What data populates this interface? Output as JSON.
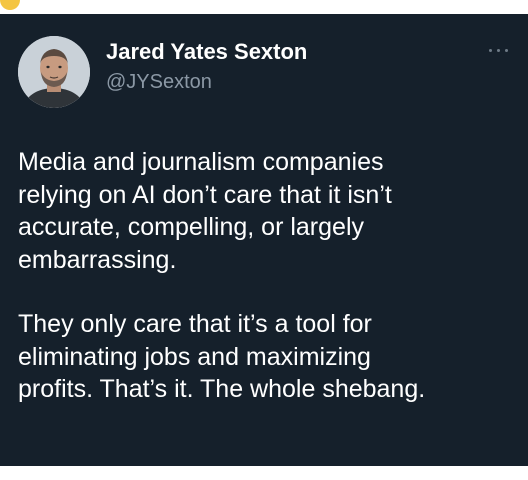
{
  "tweet": {
    "author": {
      "display_name": "Jared Yates Sexton",
      "handle": "@JYSexton",
      "avatar_icon": "profile-photo"
    },
    "more_icon": "more-horizontal-icon",
    "paragraphs": [
      {
        "lines": [
          "Media and journalism companies",
          "relying on AI don’t care that it isn’t",
          "accurate, compelling, or largely",
          "embarrassing."
        ]
      },
      {
        "lines": [
          "They only care that it’s a tool for",
          "eliminating jobs and maximizing",
          "profits. That’s it. The whole shebang."
        ]
      }
    ]
  },
  "colors": {
    "card_background": "#15202b",
    "primary_text": "#ffffff",
    "secondary_text": "#8b98a5"
  }
}
